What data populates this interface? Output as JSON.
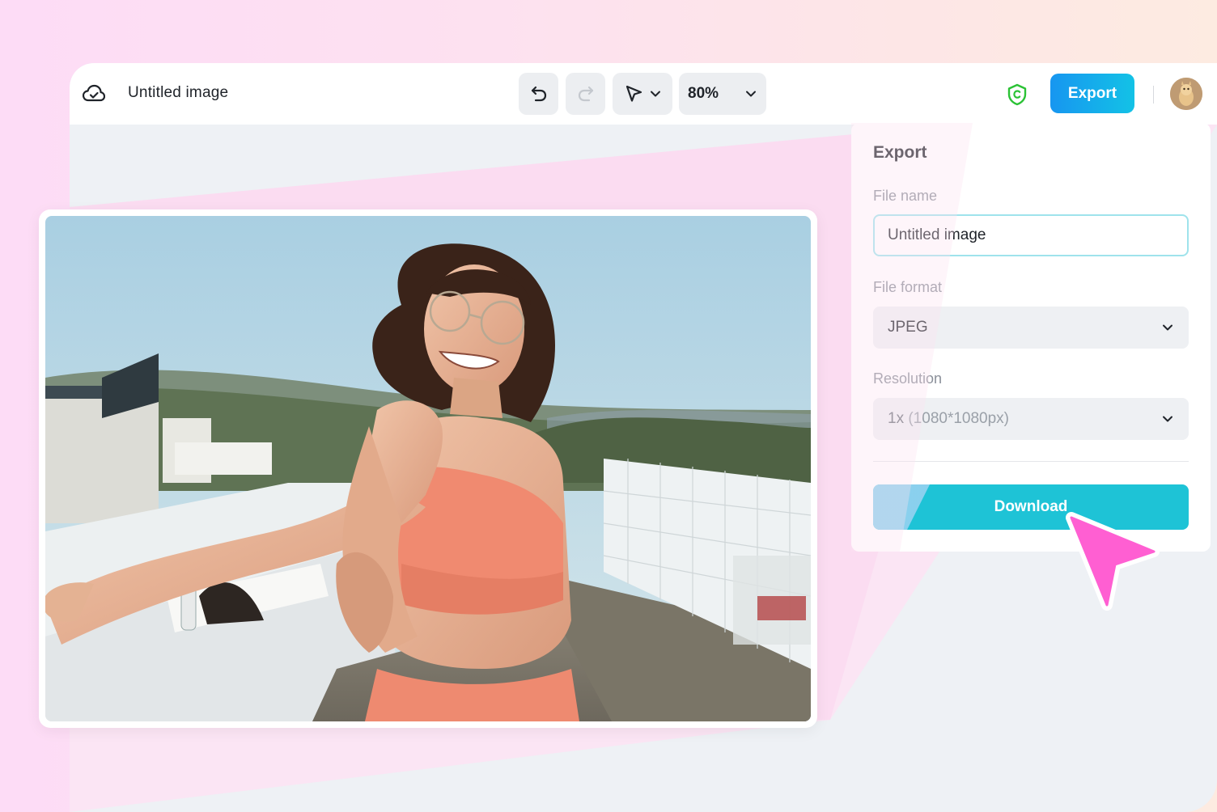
{
  "header": {
    "doc_title": "Untitled image",
    "zoom": "80%",
    "export_label": "Export"
  },
  "icons": {
    "cloud": "cloud-check-icon",
    "undo": "undo-icon",
    "redo": "redo-icon",
    "pointer": "pointer-icon",
    "chevron": "chevron-down-icon",
    "copyright": "copyright-shield-icon",
    "avatar": "avatar"
  },
  "export_panel": {
    "title": "Export",
    "file_name_label": "File name",
    "file_name_value": "Untitled image",
    "file_format_label": "File format",
    "file_format_value": "JPEG",
    "resolution_label": "Resolution",
    "resolution_prefix": "1x",
    "resolution_detail": "(1080*1080px)",
    "download_label": "Download"
  },
  "colors": {
    "accent": "#13c2e6",
    "export_gradient_start": "#1796f0",
    "download": "#1ec3d6",
    "cursor": "#ff5fd2",
    "shield": "#2bc235"
  }
}
